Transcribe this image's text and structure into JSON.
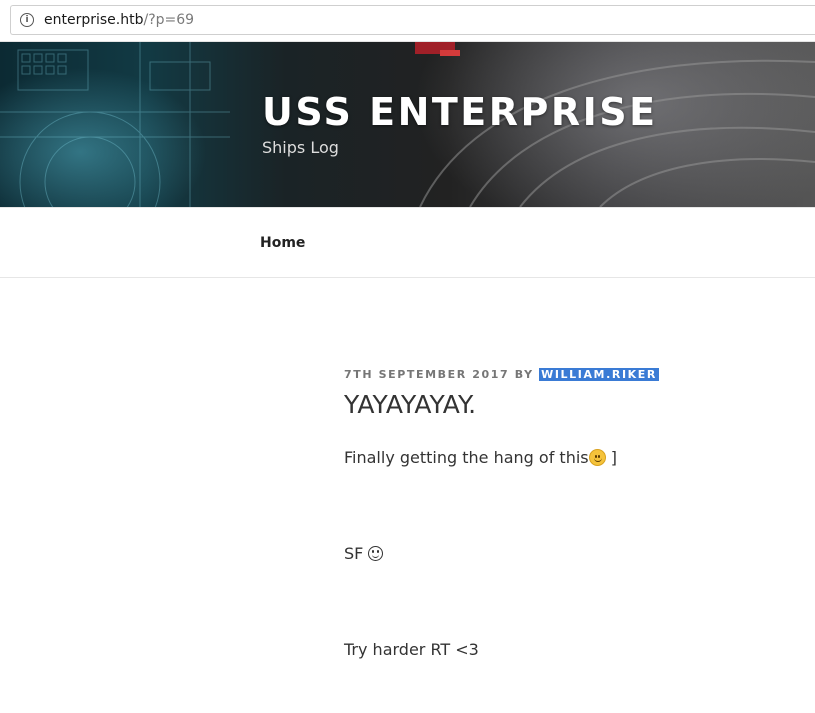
{
  "browser": {
    "url_host": "enterprise.htb",
    "url_path": "/?p=69"
  },
  "site": {
    "title": "USS ENTERPRISE",
    "description": "Ships Log"
  },
  "nav": {
    "items": [
      {
        "label": "Home"
      }
    ]
  },
  "post": {
    "date": "7TH SEPTEMBER 2017",
    "by": "BY",
    "author": "WILLIAM.RIKER",
    "title": "YAYAYAYAY.",
    "paragraphs": [
      {
        "text": "Finally getting the hang of this",
        "suffix": " ]",
        "icon": "slightly-smiling-face-icon"
      },
      {
        "text": "SF",
        "icon": "tongue-out-face-icon"
      },
      {
        "text": "Try harder RT <3"
      }
    ]
  },
  "colors": {
    "author_highlight": "#3a7bd5",
    "title_text": "#ffffff"
  }
}
